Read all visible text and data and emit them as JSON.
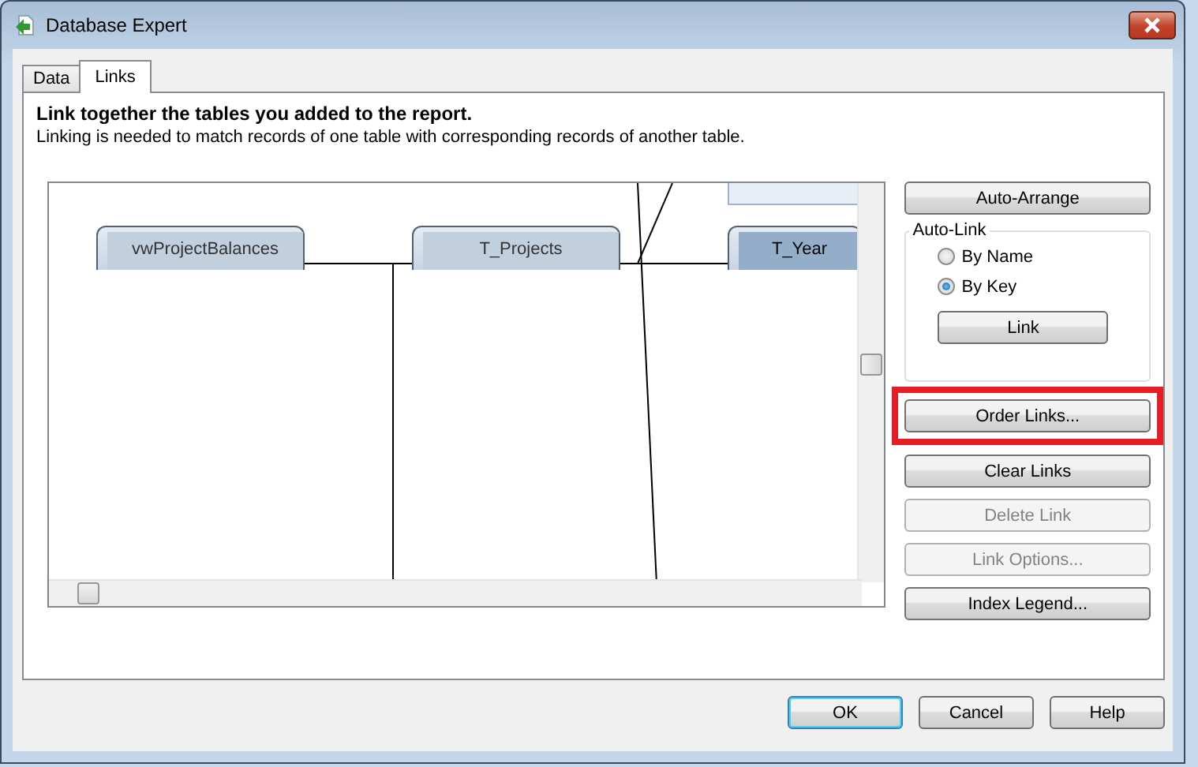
{
  "window": {
    "title": "Database Expert"
  },
  "tabs": [
    {
      "label": "Data",
      "selected": false
    },
    {
      "label": "Links",
      "selected": true
    }
  ],
  "heading": "Link together the tables you added to the report.",
  "description": "Linking is needed to match records of one table with corresponding records of another table.",
  "diagram": {
    "tables": [
      {
        "name": "vwProjectBalances",
        "selected": false
      },
      {
        "name": "T_Projects",
        "selected": false
      },
      {
        "name": "T_Year",
        "selected": true
      }
    ]
  },
  "auto_arrange_button": "Auto-Arrange",
  "auto_link": {
    "title": "Auto-Link",
    "options": [
      {
        "label": "By Name",
        "selected": false
      },
      {
        "label": "By Key",
        "selected": true
      }
    ],
    "link_button": "Link"
  },
  "actions": [
    {
      "label": "Order Links...",
      "disabled": false,
      "highlighted": true
    },
    {
      "label": "Clear Links",
      "disabled": false,
      "highlighted": false
    },
    {
      "label": "Delete Link",
      "disabled": true,
      "highlighted": false
    },
    {
      "label": "Link Options...",
      "disabled": true,
      "highlighted": false
    },
    {
      "label": "Index Legend...",
      "disabled": false,
      "highlighted": false
    }
  ],
  "footer_buttons": [
    {
      "label": "OK",
      "default": true
    },
    {
      "label": "Cancel",
      "default": false
    },
    {
      "label": "Help",
      "default": false
    }
  ]
}
